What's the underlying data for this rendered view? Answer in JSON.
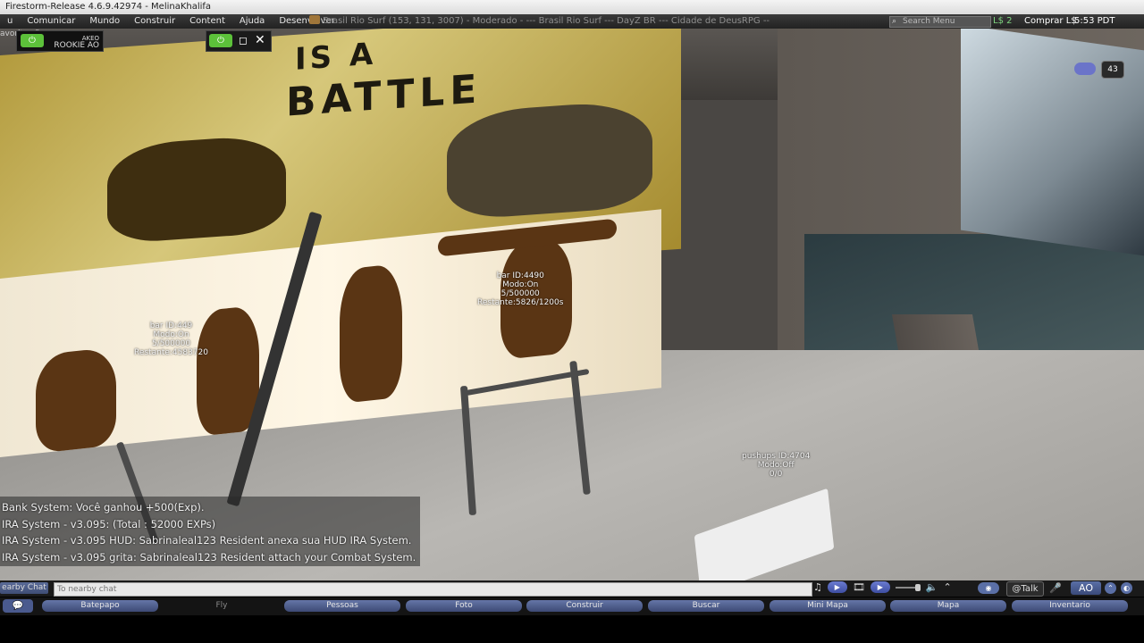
{
  "window": {
    "title": "Firestorm-Release 4.6.9.42974 - MelinaKhalifa"
  },
  "menu": {
    "items": [
      "u",
      "Comunicar",
      "Mundo",
      "Construir",
      "Content",
      "Ajuda",
      "Desenvolver"
    ],
    "status_text": "Brasil Rio Surf (153, 131, 3007) - Moderado - --- Brasil Rio Surf --- DayZ BR --- Cidade de DeusRPG --",
    "search_placeholder": "Search Menu",
    "balance": "L$ 2",
    "buy_label": "Comprar L$",
    "clock": "5:53 PDT"
  },
  "favorites_bar": "avorites Bar",
  "hud": {
    "ao_brand": "AKEO",
    "ao_label": "ROOKIE AO",
    "power_glyph": "⏻",
    "minimize_glyph": "◻",
    "close_glyph": "✕",
    "counter": "43"
  },
  "scene": {
    "poster_text_top": "IS A",
    "poster_text_main": "BATTLE",
    "labels": [
      {
        "id": "bar ID:449",
        "mode": "Modo:On",
        "progress": "5/500000",
        "remain": "Restante:4583720"
      },
      {
        "id": "bar ID:4490",
        "mode": "Modo:On",
        "progress": "5/500000",
        "remain": "Restante:5826/1200s"
      },
      {
        "id": "pushups ID:4704",
        "mode": "Modo:Off",
        "progress": "0/0",
        "remain": ""
      }
    ]
  },
  "chat": {
    "lines": [
      "Bank System: Você ganhou +500(Exp).",
      "IRA System - v3.095: (Total : 52000 EXPs)",
      "IRA System - v3.095 HUD: Sabrinaleal123 Resident anexa sua HUD IRA System.",
      "IRA System - v3.095 grita: Sabrinaleal123 Resident attach your Combat System."
    ],
    "nearby_label": "earby Chat",
    "input_placeholder": "To nearby chat",
    "talk_label": "Talk",
    "ao_label": "AO"
  },
  "toolbar": {
    "chat_icon": "💬",
    "buttons": [
      "Batepapo",
      "Fly",
      "Pessoas",
      "Foto",
      "Construir",
      "Buscar",
      "Mini Mapa",
      "Mapa",
      "Inventario"
    ]
  },
  "colors": {
    "menu_bg": "#2b2b2b",
    "accent_blue": "#5a6fa6",
    "power_green": "#5cc13a"
  }
}
